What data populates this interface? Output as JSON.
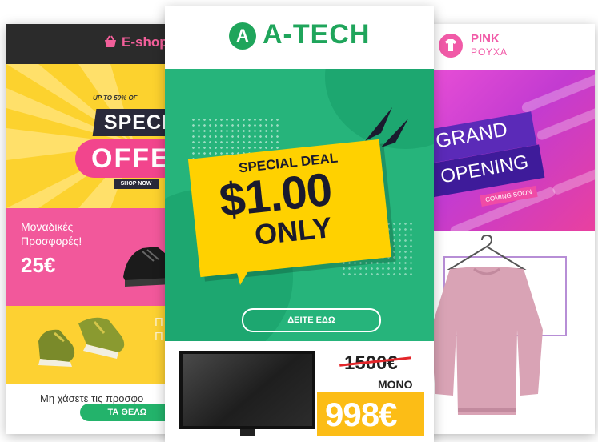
{
  "eshop": {
    "brand": "E-shop",
    "banner_top": "UP TO 50% OF",
    "banner_special": "SPECIAL",
    "banner_offer": "OFFE",
    "shop_now": "SHOP NOW",
    "promo_line1": "Μοναδικές",
    "promo_line2": "Προσφορές!",
    "promo_price": "25€",
    "ghost_line1": "Π",
    "ghost_line2": "Π",
    "miss_text": "Μη χάσετε τις προσφο",
    "cta": "ΤΑ ΘΕΛΩ",
    "colors": {
      "dark": "#2b2b2b",
      "pink": "#f2589b",
      "yellow": "#fcd22e",
      "green": "#23b36b"
    }
  },
  "atech": {
    "logo_letter": "A",
    "brand": "A-TECH",
    "hero_special": "SPECIAL DEAL",
    "hero_price": "$1.00",
    "hero_only": "ONLY",
    "cta": "ΔΕΙΤΕ ΕΔΩ",
    "old_price": "1500€",
    "mono_label": "ΜΟΝΟ",
    "new_price": "998€",
    "colors": {
      "brand": "#1fa55b",
      "hero": "#26b47b",
      "bubble": "#ffd100",
      "price_tag": "#fcbd16",
      "strike": "#e3262a"
    }
  },
  "pink": {
    "brand_line1": "PINK",
    "brand_line2": "ΡΟΥΧΑ",
    "grand": "GRAND",
    "opening": "OPENING",
    "coming_soon": "COMING SOON",
    "colors": {
      "brand": "#f15aa7",
      "purple": "#5b2ab8",
      "frame": "#b78ed6",
      "sweater": "#d9a3b5"
    }
  }
}
